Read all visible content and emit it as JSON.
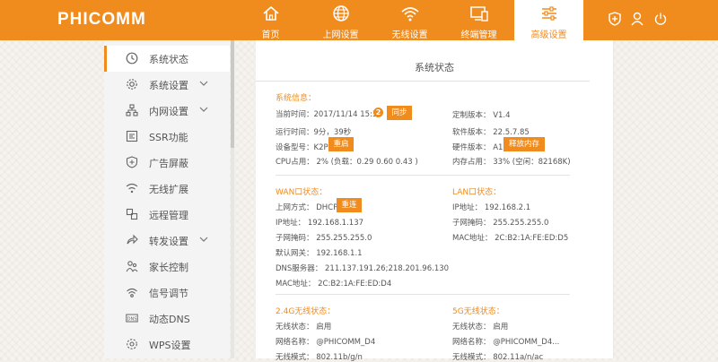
{
  "brand": "PHICOMM",
  "accent": "#f08b1d",
  "nav": [
    {
      "label": "首页",
      "icon": "home-icon"
    },
    {
      "label": "上网设置",
      "icon": "globe-icon"
    },
    {
      "label": "无线设置",
      "icon": "wifi-icon"
    },
    {
      "label": "终端管理",
      "icon": "devices-icon"
    },
    {
      "label": "高级设置",
      "icon": "sliders-icon",
      "active": true
    }
  ],
  "top_icons": [
    "shield-icon",
    "user-icon",
    "power-icon"
  ],
  "sidebar": {
    "items": [
      {
        "label": "系统状态",
        "icon": "clock-icon",
        "active": true
      },
      {
        "label": "系统设置",
        "icon": "gear-icon",
        "expandable": true
      },
      {
        "label": "内网设置",
        "icon": "network-icon",
        "expandable": true
      },
      {
        "label": "SSR功能",
        "icon": "ssr-icon"
      },
      {
        "label": "广告屏蔽",
        "icon": "shield-icon"
      },
      {
        "label": "无线扩展",
        "icon": "wifi-extend-icon"
      },
      {
        "label": "远程管理",
        "icon": "remote-icon"
      },
      {
        "label": "转发设置",
        "icon": "forward-icon",
        "expandable": true
      },
      {
        "label": "家长控制",
        "icon": "parent-icon"
      },
      {
        "label": "信号调节",
        "icon": "signal-icon"
      },
      {
        "label": "动态DNS",
        "icon": "dns-icon"
      },
      {
        "label": "WPS设置",
        "icon": "wps-icon"
      }
    ]
  },
  "main": {
    "title": "系统状态",
    "system": {
      "heading": "系统信息：",
      "current_time": "当前时间：2017/11/14 15:35",
      "sync_badge": "2",
      "sync_btn": "同步",
      "uptime": "运行时间：9分，39秒",
      "model": "设备型号：K2P",
      "reboot_btn": "重启",
      "cpu": "CPU占用：  2% (负载：0.29 0.60 0.43 )",
      "custom_version": "定制版本：  V1.4",
      "firmware": "软件版本：  22.5.7.85",
      "hardware": "硬件版本：  A1",
      "free_mem_btn": "释放内存",
      "memory": "内存占用：  33% (空闲：82168K)"
    },
    "wan": {
      "heading": "WAN口状态：",
      "mode": "上网方式：  DHCP",
      "reconnect_btn": "重连",
      "ip": "IP地址：  192.168.1.137",
      "mask": "子网掩码：  255.255.255.0",
      "gateway": "默认网关：  192.168.1.1",
      "dns": "DNS服务器：  211.137.191.26;218.201.96.130",
      "mac": "MAC地址：  2C:B2:1A:FE:ED:D4"
    },
    "lan": {
      "heading": "LAN口状态：",
      "ip": "IP地址：  192.168.2.1",
      "mask": "子网掩码：  255.255.255.0",
      "mac": "MAC地址：  2C:B2:1A:FE:ED:D5"
    },
    "wifi24": {
      "heading": "2.4G无线状态：",
      "state": "无线状态：  启用",
      "ssid": "网络名称：  @PHICOMM_D4",
      "mode": "无线模式：  802.11b/g/n"
    },
    "wifi5": {
      "heading": "5G无线状态：",
      "state": "无线状态：  启用",
      "ssid": "网络名称：  @PHICOMM_D4...",
      "mode": "无线模式：  802.11a/n/ac"
    }
  }
}
